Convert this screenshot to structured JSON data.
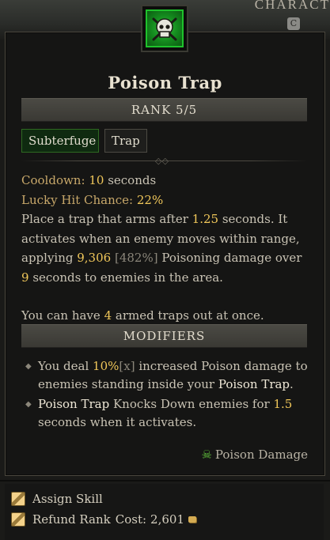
{
  "header": {
    "window_title": "CHARACT",
    "key_hint": "C"
  },
  "skill": {
    "icon": "poison-trap-skull-icon",
    "name": "Poison Trap",
    "rank_label": "RANK 5/5",
    "tags": [
      "Subterfuge",
      "Trap"
    ]
  },
  "stats": {
    "cooldown_label": "Cooldown:",
    "cooldown_value": "10",
    "cooldown_unit": "seconds",
    "lucky_label": "Lucky Hit Chance:",
    "lucky_value": "22%"
  },
  "description": {
    "p1_a": "Place a trap that arms after ",
    "arm_time": "1.25",
    "p1_b": " seconds. It activates when an enemy moves within range, applying ",
    "damage": "9,306",
    "damage_pct": "[482%]",
    "p1_c": " Poisoning damage over ",
    "duration": "9",
    "p1_d": " seconds to enemies in the area.",
    "p2_a": "You can have ",
    "trap_count": "4",
    "p2_b": " armed traps out at once."
  },
  "modifiers": {
    "title": "MODIFIERS",
    "m1_a": "You deal ",
    "m1_pct": "10%",
    "m1_x": "[x]",
    "m1_b": " increased Poison damage to enemies standing inside your ",
    "m1_skill": "Poison Trap",
    "m1_end": ".",
    "m2_skill": "Poison Trap",
    "m2_a": " Knocks Down enemies for ",
    "m2_val": "1.5",
    "m2_b": " seconds when it activates."
  },
  "damage_type": {
    "icon": "poison-skull-icon",
    "label": "Poison Damage"
  },
  "actions": {
    "assign": "Assign Skill",
    "refund": "Refund Rank",
    "cost_label": "Cost:",
    "cost_value": "2,601",
    "currency_icon": "gold-icon"
  },
  "colors": {
    "accent_gold": "#f0c75a",
    "label_tan": "#c8a86a",
    "poison_green": "#1fc22c"
  }
}
